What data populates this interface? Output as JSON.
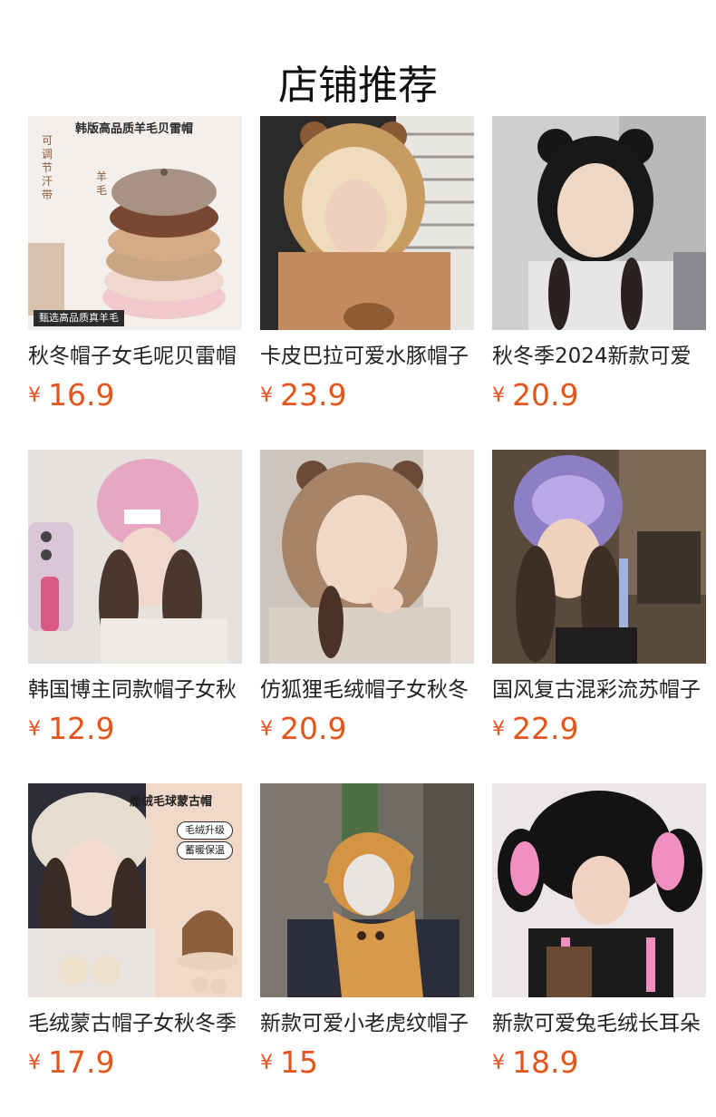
{
  "page": {
    "title": "店铺推荐"
  },
  "currency_symbol": "¥",
  "products": [
    {
      "name": "秋冬帽子女毛呢贝雷帽",
      "price": "16.9",
      "image_text": {
        "headline": "韩版高品质羊毛贝雷帽",
        "side_left": "可调节汗带",
        "side_right": "羊毛",
        "badge": "甄选高品质真羊毛"
      }
    },
    {
      "name": "卡皮巴拉可爱水豚帽子",
      "price": "23.9"
    },
    {
      "name": "秋冬季2024新款可爱",
      "price": "20.9"
    },
    {
      "name": "韩国博主同款帽子女秋",
      "price": "12.9"
    },
    {
      "name": "仿狐狸毛绒帽子女秋冬",
      "price": "20.9"
    },
    {
      "name": "国风复古混彩流苏帽子",
      "price": "22.9"
    },
    {
      "name": "毛绒蒙古帽子女秋冬季",
      "price": "17.9",
      "image_text": {
        "headline": "鹿绒毛球蒙古帽",
        "pill_1": "毛绒升级",
        "pill_2": "蓄暖保温"
      }
    },
    {
      "name": "新款可爱小老虎纹帽子",
      "price": "15"
    },
    {
      "name": "新款可爱兔毛绒长耳朵",
      "price": "18.9"
    }
  ],
  "colors": {
    "price": "#e4541b",
    "title": "#111111",
    "name": "#222222"
  }
}
